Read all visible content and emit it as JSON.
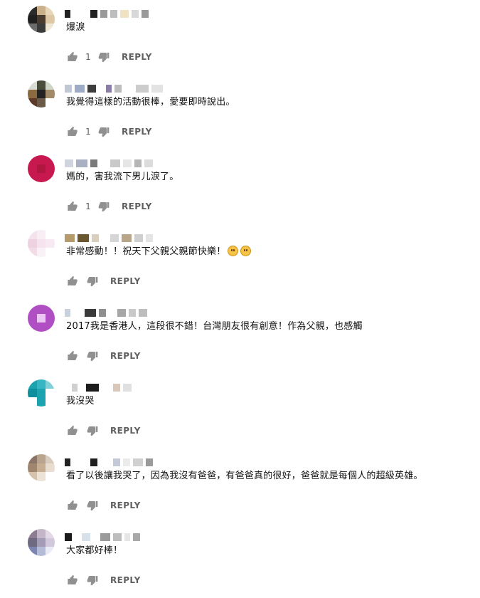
{
  "reply_label": "REPLY",
  "colors": {
    "icon": "#909090",
    "text": "#111111",
    "action_text": "#606060"
  },
  "comments": [
    {
      "text": "爆淚",
      "likes": "1",
      "emojis": [],
      "avatar": [
        "#2b2b2b",
        "#c9b08a",
        "#e8d6b8",
        "#1f1f1f",
        "#4a3b30",
        "#dcc8a5",
        "#6b6b6b",
        "#3a3a3a",
        "#efe6d6"
      ],
      "author_blocks": [
        [
          "#222222",
          8
        ],
        [
          "#ffffff",
          20
        ],
        [
          "#222222",
          10
        ],
        [
          "#9a9a9a",
          10
        ],
        [
          "#bdbdbd",
          10
        ],
        [
          "#efe3c4",
          12
        ],
        [
          "#d8d8d8",
          10
        ],
        [
          "#9a9a9a",
          10
        ]
      ]
    },
    {
      "text": "我覺得這樣的活動很棒，愛要即時說出。",
      "likes": "1",
      "emojis": [],
      "avatar": [
        "#d9dcd3",
        "#4b4d3c",
        "#cfd5c7",
        "#8b6a3f",
        "#222222",
        "#a08a67",
        "#5b3a2a",
        "#6b5a48",
        "#ffffff"
      ],
      "author_blocks": [
        [
          "#c0c8d6",
          10
        ],
        [
          "#9eabc6",
          14
        ],
        [
          "#3d3d3d",
          12
        ],
        [
          "#ffffff",
          6
        ],
        [
          "#8b7ca8",
          8
        ],
        [
          "#bdbdbd",
          10
        ],
        [
          "#ffffff",
          12
        ],
        [
          "#cccccc",
          18
        ],
        [
          "#e3e3e3",
          16
        ]
      ]
    },
    {
      "text": "媽的，害我流下男儿淚了。",
      "likes": "1",
      "emojis": [],
      "avatar": [
        "#c7194f",
        "#c7194f",
        "#c7194f",
        "#c7194f",
        "#b0163f",
        "#c7194f",
        "#c7194f",
        "#c7194f",
        "#c7194f"
      ],
      "author_blocks": [
        [
          "#d0d4de",
          12
        ],
        [
          "#a9b0c2",
          16
        ],
        [
          "#7a7a7a",
          10
        ],
        [
          "#ffffff",
          10
        ],
        [
          "#c9c9c9",
          14
        ],
        [
          "#e6e6e6",
          12
        ],
        [
          "#b5b5b5",
          10
        ],
        [
          "#dcdcdc",
          12
        ]
      ]
    },
    {
      "text": "非常感動！！祝天下父親父親節快樂！",
      "likes": "",
      "emojis": [
        "sad-face-emoji",
        "smiling-face-emoji"
      ],
      "avatar": [
        "#f4e2ec",
        "#f8eef4",
        "#ffffff",
        "#efd2e1",
        "#f6e3ee",
        "#f7eaf2",
        "#f3dbe8",
        "#f9f1f6",
        "#ffffff"
      ],
      "author_blocks": [
        [
          "#b59a6b",
          14
        ],
        [
          "#6b5730",
          16
        ],
        [
          "#d8cfbf",
          10
        ],
        [
          "#ffffff",
          8
        ],
        [
          "#d6d6d6",
          12
        ],
        [
          "#b8a58a",
          14
        ],
        [
          "#cfcfcf",
          12
        ],
        [
          "#e4e4e4",
          10
        ]
      ]
    },
    {
      "text": "2017我是香港人，這段很不錯！台灣朋友很有創意！作為父親，也感觸",
      "likes": "",
      "emojis": [],
      "avatar": [
        "#b04fc4",
        "#b04fc4",
        "#b04fc4",
        "#b04fc4",
        "#ecc6f3",
        "#b04fc4",
        "#b04fc4",
        "#b04fc4",
        "#b04fc4"
      ],
      "author_blocks": [
        [
          "#c8d2dc",
          8
        ],
        [
          "#ffffff",
          12
        ],
        [
          "#3a3a3a",
          16
        ],
        [
          "#8f8f8f",
          10
        ],
        [
          "#ffffff",
          8
        ],
        [
          "#a6a6a6",
          12
        ],
        [
          "#c9c9c9",
          10
        ],
        [
          "#bdbdbd",
          12
        ]
      ]
    },
    {
      "text": "我沒哭",
      "likes": "",
      "emojis": [],
      "avatar": [
        "#1ba3b0",
        "#36b6c2",
        "#7fd0d8",
        "#0f8f9c",
        "#1ba3b0",
        "#ffffff",
        "#ffffff",
        "#1ba3b0",
        "#ffffff"
      ],
      "author_blocks": [
        [
          "#ffffff",
          6
        ],
        [
          "#cfcfcf",
          8
        ],
        [
          "#ffffff",
          4
        ],
        [
          "#1c1c1c",
          18
        ],
        [
          "#ffffff",
          12
        ],
        [
          "#d9c7b9",
          10
        ],
        [
          "#e0e0e0",
          12
        ],
        [
          "#ffffff",
          8
        ]
      ]
    },
    {
      "text": "看了以後讓我哭了，因為我沒有爸爸，有爸爸真的很好，爸爸就是每個人的超級英雄。",
      "likes": "",
      "emojis": [],
      "avatar": [
        "#8a7566",
        "#b9a58f",
        "#d9cbbd",
        "#a0866f",
        "#c7ad92",
        "#e9ddd0",
        "#d5c2ad",
        "#ece2d6",
        "#ffffff"
      ],
      "author_blocks": [
        [
          "#222222",
          8
        ],
        [
          "#ffffff",
          20
        ],
        [
          "#1f1f1f",
          10
        ],
        [
          "#ffffff",
          14
        ],
        [
          "#c3c9d6",
          10
        ],
        [
          "#ebebeb",
          10
        ],
        [
          "#d0d0d0",
          14
        ],
        [
          "#9a9a9a",
          10
        ]
      ]
    },
    {
      "text": "大家都好棒！",
      "likes": "",
      "emojis": [],
      "avatar": [
        "#8e7d92",
        "#c4b6c8",
        "#e3d8e6",
        "#6e6a7f",
        "#a49cb6",
        "#d2c8dc",
        "#7d86b3",
        "#b5bcd8",
        "#e9ebf5"
      ],
      "author_blocks": [
        [
          "#1a1a1a",
          10
        ],
        [
          "#ffffff",
          6
        ],
        [
          "#d8e1ea",
          12
        ],
        [
          "#ffffff",
          6
        ],
        [
          "#9a9a9a",
          14
        ],
        [
          "#bdbdbd",
          12
        ],
        [
          "#e6e6e6",
          8
        ],
        [
          "#a8a8a8",
          10
        ]
      ]
    }
  ]
}
